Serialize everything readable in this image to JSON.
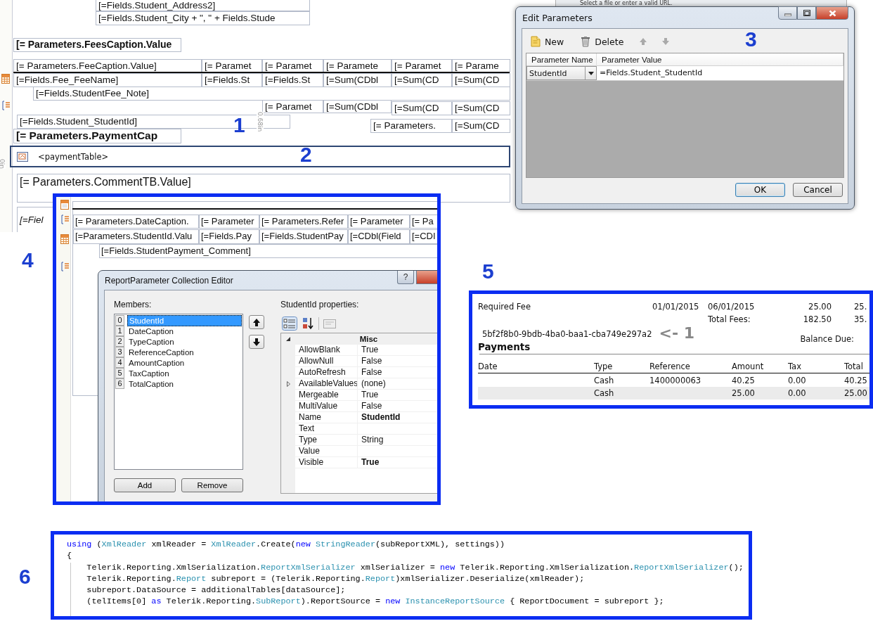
{
  "designer": {
    "items": [
      {
        "text": "[=Fields.Student_Address2]",
        "kind": "normal"
      },
      {
        "text": "[=Fields.Student_City + \",  \" + Fields.Stude",
        "kind": "normal"
      },
      {
        "text": "[= Parameters.FeesCaption.Value",
        "kind": "bold"
      },
      {
        "text": "[= Parameters.FeeCaption.Value]",
        "kind": "normal"
      },
      {
        "text": "[= Paramet",
        "kind": "normal"
      },
      {
        "text": "[= Paramet",
        "kind": "normal"
      },
      {
        "text": "[= Paramete",
        "kind": "normal"
      },
      {
        "text": "[= Paramet",
        "kind": "normal"
      },
      {
        "text": "[= Parame",
        "kind": "normal"
      },
      {
        "text": "[=Fields.Fee_FeeName]",
        "kind": "normal"
      },
      {
        "text": "[=Fields.St",
        "kind": "normal"
      },
      {
        "text": "[=Fields.St",
        "kind": "normal"
      },
      {
        "text": "[=Sum(CDbl",
        "kind": "normal"
      },
      {
        "text": "[=Sum(CD",
        "kind": "normal"
      },
      {
        "text": "[=Sum(CD",
        "kind": "normal"
      },
      {
        "text": "[=Fields.StudentFee_Note]",
        "kind": "normal"
      },
      {
        "text": "[= Paramet",
        "kind": "normal"
      },
      {
        "text": "[=Sum(CDbl",
        "kind": "normal"
      },
      {
        "text": "[=Sum(CD",
        "kind": "normal"
      },
      {
        "text": "[=Sum(CD",
        "kind": "normal"
      },
      {
        "text": "[=Fields.Student_StudentId]",
        "kind": "normal"
      },
      {
        "text": "[= Parameters.",
        "kind": "normal"
      },
      {
        "text": "[=Sum(CD",
        "kind": "normal"
      },
      {
        "text": "[= Parameters.PaymentCap",
        "kind": "large-bold"
      },
      {
        "text": "[= Parameters.CommentTB.Value]",
        "kind": "large"
      },
      {
        "text": "[=Fiel",
        "kind": "italic"
      }
    ],
    "ruler_labels": [
      "0.68in",
      "0in"
    ],
    "payment_table": {
      "text": "<paymentTable>",
      "selected": true
    }
  },
  "callouts": [
    "1",
    "2",
    "3",
    "4",
    "5",
    "6"
  ],
  "background_window": {
    "hint": "Select a file or enter a valid URL."
  },
  "edit_parameters": {
    "title": "Edit Parameters",
    "toolbar": [
      "New",
      "Delete"
    ],
    "columns": [
      "Parameter Name",
      "Parameter Value"
    ],
    "rows": [
      {
        "name": "StudentId",
        "value": "=Fields.Student_StudentId"
      }
    ],
    "buttons": [
      {
        "label": "OK",
        "default": true
      },
      {
        "label": "Cancel",
        "default": false
      }
    ]
  },
  "panel_4": {
    "header_cells": [
      "[= Parameters.DateCaption.",
      "[= Parameter",
      "[= Parameters.Refer",
      "[= Parameter",
      "[= Pa"
    ],
    "detail_cells": [
      "[=Parameters.StudentId.Valu",
      "[=Fields.Pay",
      "[=Fields.StudentPay",
      "[=CDbl(Field",
      "[=CDI"
    ],
    "comment": "[=Fields.StudentPayment_Comment]",
    "dialog": {
      "title": "ReportParameter Collection Editor",
      "help": "?",
      "members_label": "Members:",
      "members": [
        {
          "index": "0",
          "name": "StudentId",
          "selected": true
        },
        {
          "index": "1",
          "name": "DateCaption",
          "selected": false
        },
        {
          "index": "2",
          "name": "TypeCaption",
          "selected": false
        },
        {
          "index": "3",
          "name": "ReferenceCaption",
          "selected": false
        },
        {
          "index": "4",
          "name": "AmountCaption",
          "selected": false
        },
        {
          "index": "5",
          "name": "TaxCaption",
          "selected": false
        },
        {
          "index": "6",
          "name": "TotalCaption",
          "selected": false
        }
      ],
      "properties_label": "StudentId properties:",
      "category": {
        "name": "Misc",
        "expanded": true
      },
      "properties": [
        {
          "name": "AllowBlank",
          "value": "True",
          "bold": false,
          "expandable": false
        },
        {
          "name": "AllowNull",
          "value": "False",
          "bold": false,
          "expandable": false
        },
        {
          "name": "AutoRefresh",
          "value": "False",
          "bold": false,
          "expandable": false
        },
        {
          "name": "AvailableValues",
          "value": "(none)",
          "bold": false,
          "expandable": true
        },
        {
          "name": "Mergeable",
          "value": "True",
          "bold": false,
          "expandable": false
        },
        {
          "name": "MultiValue",
          "value": "False",
          "bold": false,
          "expandable": false
        },
        {
          "name": "Name",
          "value": "StudentId",
          "bold": true,
          "expandable": false
        },
        {
          "name": "Text",
          "bold": false,
          "expandable": false
        },
        {
          "name": "Type",
          "value": "String",
          "bold": false,
          "expandable": false
        },
        {
          "name": "Value",
          "bold": false,
          "expandable": false
        },
        {
          "name": "Visible",
          "value": "True",
          "bold": true,
          "expandable": false
        }
      ],
      "buttons": [
        "Add",
        "Remove"
      ]
    }
  },
  "panel_5": {
    "fees": [
      {
        "name": "Required Fee",
        "start": "01/01/2015",
        "end": "06/01/2015",
        "amount": "25.00",
        "column_6": "25."
      }
    ],
    "total_label": "Total Fees:",
    "total": "182.50",
    "total_column_6": "35.",
    "student_id": "5bf2f8b0-9bdb-4ba0-baa1-cba749e297a2",
    "annotation": "<- 1",
    "balance_label": "Balance Due:",
    "section": "Payments",
    "columns": [
      "Date",
      "Type",
      "Reference",
      "Amount",
      "Tax",
      "Total"
    ],
    "rows": [
      {
        "type": "Cash",
        "reference": "1400000063",
        "amount": "40.25",
        "tax": "0.00",
        "total": "40.25"
      },
      {
        "type": "Cash",
        "amount": "25.00",
        "tax": "0.00",
        "total": "25.00"
      }
    ]
  },
  "panel_6": {
    "lines": [
      {
        "tokens": [
          {
            "text": "using",
            "kind": "keyword"
          },
          {
            "text": " (",
            "kind": "plain"
          },
          {
            "text": "XmlReader",
            "kind": "type"
          },
          {
            "text": " xmlReader = ",
            "kind": "plain"
          },
          {
            "text": "XmlReader",
            "kind": "type"
          },
          {
            "text": ".Create(",
            "kind": "plain"
          },
          {
            "text": "new",
            "kind": "keyword"
          },
          {
            "text": " StringReader",
            "kind": "type"
          },
          {
            "text": "(subReportXML), settings))",
            "kind": "plain"
          }
        ]
      },
      {
        "tokens": [
          {
            "text": "{",
            "kind": "plain"
          }
        ]
      },
      {
        "tokens": [
          {
            "text": "    Telerik.Reporting.XmlSerialization.",
            "kind": "plain"
          },
          {
            "text": "ReportXmlSerializer",
            "kind": "type"
          },
          {
            "text": " xmlSerializer = ",
            "kind": "plain"
          },
          {
            "text": "new",
            "kind": "keyword"
          },
          {
            "text": " Telerik.Reporting.XmlSerialization.",
            "kind": "plain"
          },
          {
            "text": "ReportXmlSerializer",
            "kind": "type"
          },
          {
            "text": "();",
            "kind": "plain"
          }
        ]
      },
      {
        "tokens": [
          {
            "text": "    Telerik.Reporting.",
            "kind": "plain"
          },
          {
            "text": "Report",
            "kind": "type"
          },
          {
            "text": " subreport = (Telerik.Reporting.",
            "kind": "plain"
          },
          {
            "text": "Report",
            "kind": "type"
          },
          {
            "text": ")xmlSerializer.Deserialize(xmlReader);",
            "kind": "plain"
          }
        ]
      },
      {
        "tokens": [
          {
            "text": "    subreport.DataSource = additionalTables[dataSource];",
            "kind": "plain"
          }
        ]
      },
      {
        "tokens": [
          {
            "text": "    (telItems[0] ",
            "kind": "plain"
          },
          {
            "text": "as",
            "kind": "keyword"
          },
          {
            "text": " Telerik.Reporting.",
            "kind": "plain"
          },
          {
            "text": "SubReport",
            "kind": "type"
          },
          {
            "text": ").ReportSource = ",
            "kind": "plain"
          },
          {
            "text": "new",
            "kind": "keyword"
          },
          {
            "text": " InstanceReportSource",
            "kind": "type"
          },
          {
            "text": " { ReportDocument = subreport };",
            "kind": "plain"
          }
        ]
      }
    ]
  }
}
